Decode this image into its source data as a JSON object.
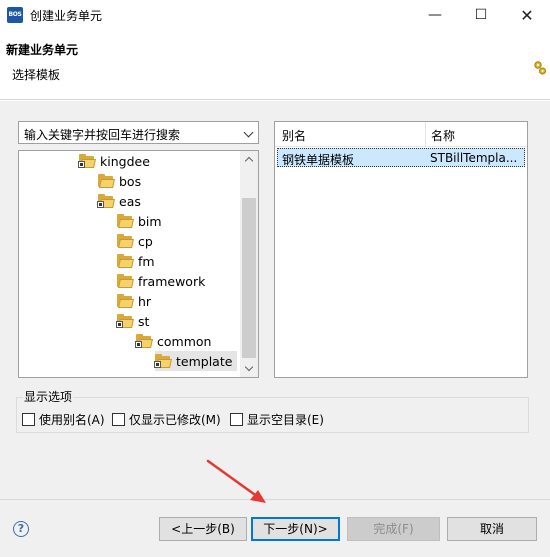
{
  "window": {
    "icon_text": "BOS",
    "title": "创建业务单元",
    "minimize": "—",
    "maximize": "☐",
    "close": "✕"
  },
  "banner": {
    "title": "新建业务单元",
    "subtitle": "选择模板"
  },
  "search": {
    "placeholder": "输入关键字并按回车进行搜索"
  },
  "tree": {
    "items": [
      {
        "label": "kingdee",
        "pkg": true
      },
      {
        "label": "bos",
        "pkg": false
      },
      {
        "label": "eas",
        "pkg": true
      },
      {
        "label": "bim",
        "pkg": false
      },
      {
        "label": "cp",
        "pkg": false
      },
      {
        "label": "fm",
        "pkg": false
      },
      {
        "label": "framework",
        "pkg": false
      },
      {
        "label": "hr",
        "pkg": false
      },
      {
        "label": "st",
        "pkg": true
      },
      {
        "label": "common",
        "pkg": true
      },
      {
        "label": "template",
        "pkg": true,
        "selected": true
      }
    ]
  },
  "table": {
    "columns": [
      "别名",
      "名称"
    ],
    "rows": [
      {
        "alias": "钢铁单据模板",
        "name": "STBillTempla..."
      }
    ]
  },
  "display_options": {
    "label": "显示选项",
    "options": [
      {
        "label": "使用别名(A)",
        "checked": false
      },
      {
        "label": "仅显示已修改(M)",
        "checked": false
      },
      {
        "label": "显示空目录(E)",
        "checked": false
      }
    ]
  },
  "footer": {
    "help_icon": "?",
    "back": "<上一步(B)",
    "next": "下一步(N)>",
    "finish": "完成(F)",
    "cancel": "取消"
  },
  "colors": {
    "selection": "#cce8ff",
    "default_button_border": "#0078d7",
    "annotation_arrow": "#e53935"
  }
}
